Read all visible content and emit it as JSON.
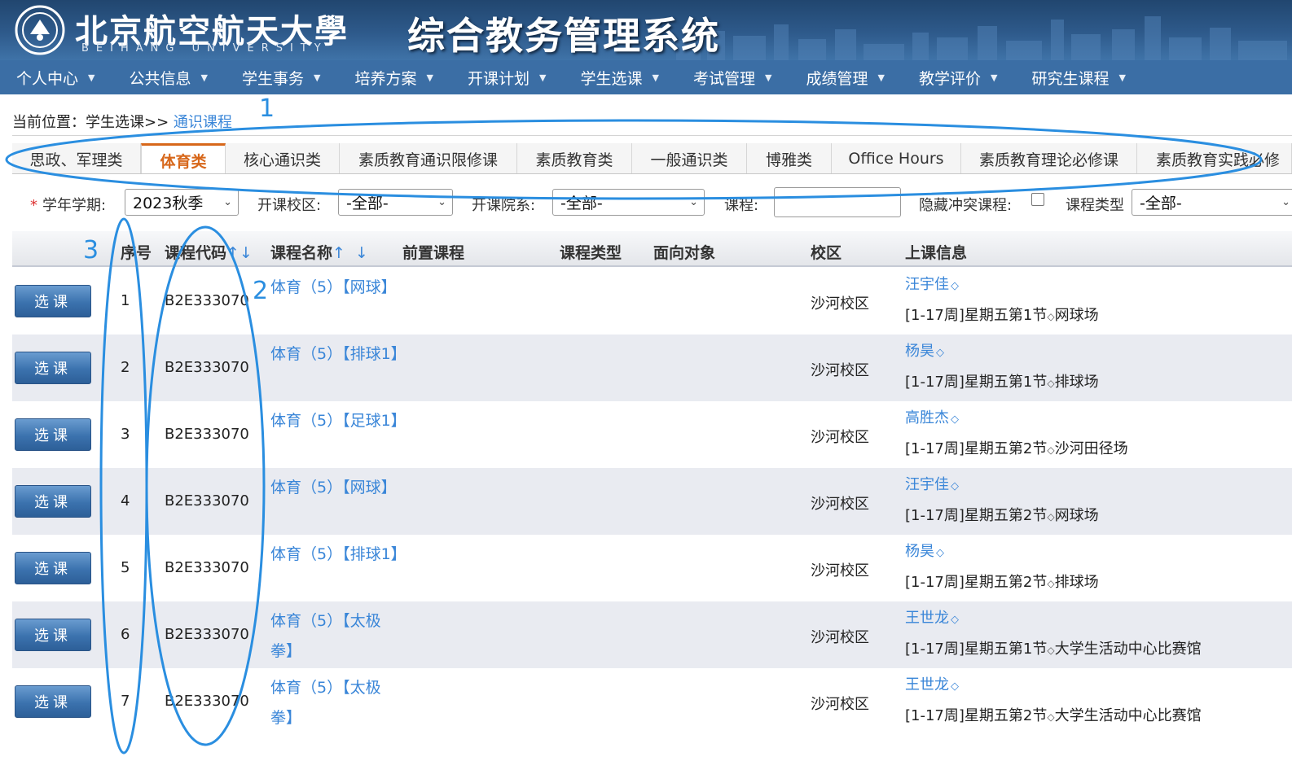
{
  "header": {
    "university_name": "北京航空航天大學",
    "university_en": "BEIHANG UNIVERSITY",
    "system_name": "综合教务管理系统"
  },
  "nav": [
    {
      "label": "个人中心"
    },
    {
      "label": "公共信息"
    },
    {
      "label": "学生事务"
    },
    {
      "label": "培养方案"
    },
    {
      "label": "开课计划"
    },
    {
      "label": "学生选课"
    },
    {
      "label": "考试管理"
    },
    {
      "label": "成绩管理"
    },
    {
      "label": "教学评价"
    },
    {
      "label": "研究生课程"
    }
  ],
  "breadcrumb": {
    "prefix": "当前位置：学生选课>>",
    "current": "通识课程"
  },
  "tabs": [
    {
      "label": "思政、军理类",
      "active": false
    },
    {
      "label": "体育类",
      "active": true
    },
    {
      "label": "核心通识类",
      "active": false
    },
    {
      "label": "素质教育通识限修课",
      "active": false
    },
    {
      "label": "素质教育类",
      "active": false
    },
    {
      "label": "一般通识类",
      "active": false
    },
    {
      "label": "博雅类",
      "active": false
    },
    {
      "label": "Office Hours",
      "active": false
    },
    {
      "label": "素质教育理论必修课",
      "active": false
    },
    {
      "label": "素质教育实践必修",
      "active": false
    }
  ],
  "filters": {
    "required_mark": "*",
    "term_label": "学年学期:",
    "term_value": "2023秋季",
    "campus_label": "开课校区:",
    "campus_value": "-全部-",
    "dept_label": "开课院系:",
    "dept_value": "-全部-",
    "course_label": "课程:",
    "course_value": "",
    "hide_conflict_label": "隐藏冲突课程:",
    "type_label": "课程类型",
    "type_value": "-全部-"
  },
  "table": {
    "headers": {
      "index": "序号",
      "code": "课程代码",
      "name": "课程名称",
      "prereq": "前置课程",
      "type": "课程类型",
      "target": "面向对象",
      "campus": "校区",
      "schedule": "上课信息"
    },
    "sort_up": "↑",
    "sort_down": "↓",
    "select_button": "选课",
    "rows": [
      {
        "index": "1",
        "code": "B2E333070",
        "name": "体育（5）【网球】",
        "campus": "沙河校区",
        "teacher": "汪宇佳",
        "schedule_a": "[1-17周]星期五第1节",
        "schedule_b": "网球场"
      },
      {
        "index": "2",
        "code": "B2E333070",
        "name": "体育（5）【排球1】",
        "campus": "沙河校区",
        "teacher": "杨昊",
        "schedule_a": "[1-17周]星期五第1节",
        "schedule_b": "排球场"
      },
      {
        "index": "3",
        "code": "B2E333070",
        "name": "体育（5）【足球1】",
        "campus": "沙河校区",
        "teacher": "高胜杰",
        "schedule_a": "[1-17周]星期五第2节",
        "schedule_b": "沙河田径场"
      },
      {
        "index": "4",
        "code": "B2E333070",
        "name": "体育（5）【网球】",
        "campus": "沙河校区",
        "teacher": "汪宇佳",
        "schedule_a": "[1-17周]星期五第2节",
        "schedule_b": "网球场"
      },
      {
        "index": "5",
        "code": "B2E333070",
        "name": "体育（5）【排球1】",
        "campus": "沙河校区",
        "teacher": "杨昊",
        "schedule_a": "[1-17周]星期五第2节",
        "schedule_b": "排球场"
      },
      {
        "index": "6",
        "code": "B2E333070",
        "name": "体育（5）【太极拳】",
        "campus": "沙河校区",
        "teacher": "王世龙",
        "schedule_a": "[1-17周]星期五第1节",
        "schedule_b": "大学生活动中心比赛馆"
      },
      {
        "index": "7",
        "code": "B2E333070",
        "name": "体育（5）【太极拳】",
        "campus": "沙河校区",
        "teacher": "王世龙",
        "schedule_a": "[1-17周]星期五第2节",
        "schedule_b": "大学生活动中心比赛馆"
      }
    ]
  },
  "annotations": {
    "label_1": "1",
    "label_2": "2",
    "label_3": "3",
    "color": "#2a8ee0"
  }
}
